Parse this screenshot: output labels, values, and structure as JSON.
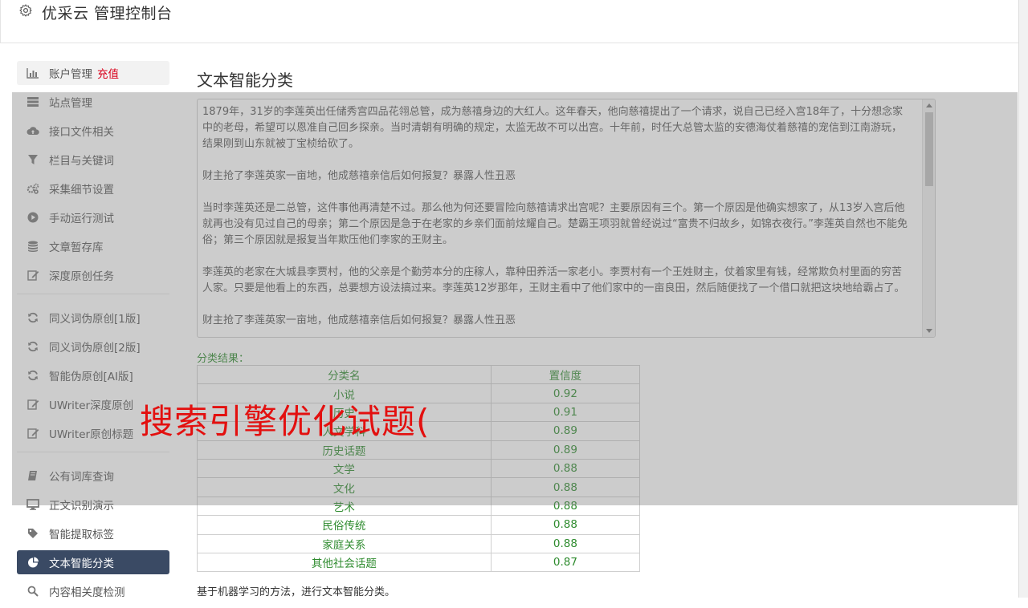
{
  "header": {
    "title": "优采云 管理控制台",
    "icon": "gear-icon"
  },
  "sidebar": {
    "items": [
      {
        "label": "账户管理",
        "icon": "bar-chart-icon",
        "badge": "充值"
      },
      {
        "label": "站点管理",
        "icon": "server-icon"
      },
      {
        "label": "接口文件相关",
        "icon": "cloud-upload-icon"
      },
      {
        "label": "栏目与关键词",
        "icon": "filter-icon"
      },
      {
        "label": "采集细节设置",
        "icon": "gears-icon"
      },
      {
        "label": "手动运行测试",
        "icon": "play-circle-icon"
      },
      {
        "label": "文章暂存库",
        "icon": "database-icon"
      },
      {
        "label": "深度原创任务",
        "icon": "edit-icon"
      },
      {
        "label": "同义词伪原创[1版]",
        "icon": "refresh-icon"
      },
      {
        "label": "同义词伪原创[2版]",
        "icon": "refresh-icon"
      },
      {
        "label": "智能伪原创[AI版]",
        "icon": "refresh-icon"
      },
      {
        "label": "UWriter深度原创",
        "icon": "edit-icon"
      },
      {
        "label": "UWriter原创标题",
        "icon": "edit-icon"
      },
      {
        "label": "公有词库查询",
        "icon": "book-icon"
      },
      {
        "label": "正文识别演示",
        "icon": "monitor-icon"
      },
      {
        "label": "智能提取标签",
        "icon": "tag-icon"
      },
      {
        "label": "文本智能分类",
        "icon": "pie-chart-icon"
      },
      {
        "label": "内容相关度检测",
        "icon": "search-icon"
      }
    ]
  },
  "main": {
    "title": "文本智能分类",
    "text_paragraphs": [
      "1879年，31岁的李莲英出任储秀宫四品花翎总管，成为慈禧身边的大红人。这年春天，他向慈禧提出了一个请求，说自己已经入宫18年了，十分想念家中的老母，希望可以恩准自己回乡探亲。当时清朝有明确的规定，太监无故不可以出宫。十年前，时任大总管太监的安德海仗着慈禧的宠信到江南游玩，结果刚到山东就被丁宝桢给砍了。",
      "财主抢了李莲英家一亩地，他成慈禧亲信后如何报复？暴露人性丑恶",
      "当时李莲英还是二总管，这件事他再清楚不过。那么他为何还要冒险向慈禧请求出宫呢？主要原因有三个。第一个原因是他确实想家了，从13岁入宫后他就再也没有见过自己的母亲；第二个原因是急于在老家的乡亲们面前炫耀自己。楚霸王项羽就曾经说过“富贵不归故乡，如锦衣夜行。”李莲英自然也不能免俗；第三个原因就是报复当年欺压他们李家的王财主。",
      "李莲英的老家在大城县李贾村，他的父亲是个勤劳本分的庄稼人，靠种田养活一家老小。李贾村有一个王姓财主，仗着家里有钱，经常欺负村里面的穷苦人家。只要是他看上的东西，总要想方设法搞过来。李莲英12岁那年，王财主看中了他们家中的一亩良田，然后随便找了一个借口就把这块地给霸占了。",
      "财主抢了李莲英家一亩地，他成慈禧亲信后如何报复？暴露人性丑恶"
    ],
    "result_label": "分类结果：",
    "table": {
      "headers": [
        "分类名",
        "置信度"
      ],
      "rows": [
        [
          "小说",
          "0.92"
        ],
        [
          "历史",
          "0.91"
        ],
        [
          "人文学科",
          "0.89"
        ],
        [
          "历史话题",
          "0.89"
        ],
        [
          "文学",
          "0.88"
        ],
        [
          "文化",
          "0.88"
        ],
        [
          "艺术",
          "0.88"
        ],
        [
          "民俗传统",
          "0.88"
        ],
        [
          "家庭关系",
          "0.88"
        ],
        [
          "其他社会话题",
          "0.87"
        ]
      ]
    },
    "description": "基于机器学习的方法，进行文本智能分类。"
  },
  "watermark": "搜索引擎优化试题(",
  "colors": {
    "accent": "#3a4a64",
    "result_green": "#2e8b2e",
    "watermark_red": "#e3100f",
    "recharge_red": "#d9001b"
  }
}
